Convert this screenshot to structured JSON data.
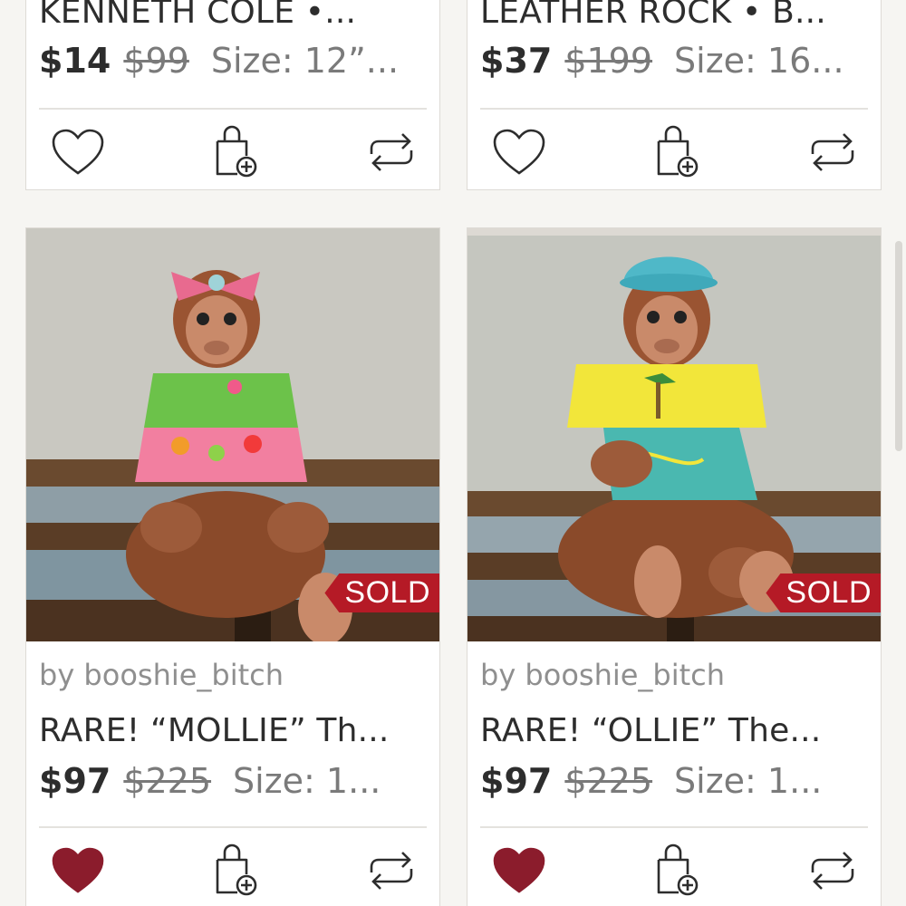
{
  "listings": [
    {
      "title": "KENNETH COLE •...",
      "price": "$14",
      "original_price": "$99",
      "size": "Size: 12”...",
      "liked": false
    },
    {
      "title": "LEATHER ROCK • B...",
      "price": "$37",
      "original_price": "$199",
      "size": "Size: 16...",
      "liked": false
    },
    {
      "seller": "by booshie_bitch",
      "title": "RARE! “MOLLIE” Th...",
      "price": "$97",
      "original_price": "$225",
      "size": "Size: 1...",
      "badge": "SOLD",
      "liked": true
    },
    {
      "seller": "by booshie_bitch",
      "title": "RARE! “OLLIE” The...",
      "price": "$97",
      "original_price": "$225",
      "size": "Size: 1...",
      "badge": "SOLD",
      "liked": true
    }
  ],
  "icons": {
    "like": "heart-icon",
    "bag": "shopping-bag-add-icon",
    "share": "share-repeat-icon"
  },
  "colors": {
    "liked_heart": "#8b1c2c",
    "sold_badge": "#b51a26"
  }
}
